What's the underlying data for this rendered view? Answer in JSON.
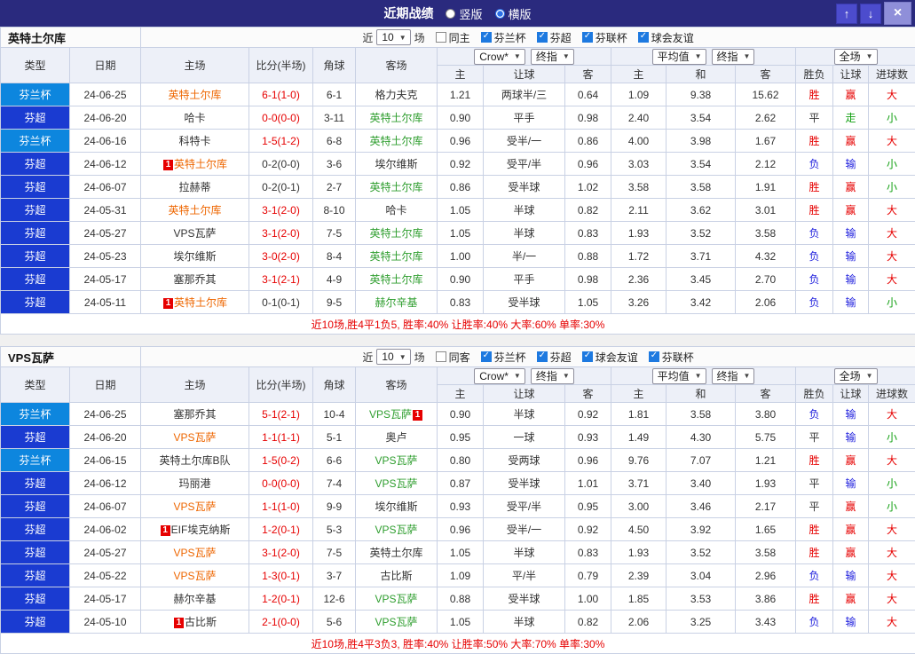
{
  "topbar": {
    "title": "近期战绩",
    "radios": [
      {
        "label": "竖版",
        "checked": false
      },
      {
        "label": "横版",
        "checked": true
      }
    ],
    "up_icon": "↑",
    "down_icon": "↓",
    "close_icon": "×"
  },
  "recent": {
    "prefix": "近",
    "suffix": "场"
  },
  "columns": [
    "类型",
    "日期",
    "主场",
    "比分(半场)",
    "角球",
    "客场",
    "主",
    "让球",
    "客",
    "主",
    "和",
    "客",
    "胜负",
    "让球",
    "进球数"
  ],
  "selects": {
    "book": "Crow*",
    "final1": "终指",
    "avg": "平均值",
    "final2": "终指",
    "scope": "全场"
  },
  "colors": {
    "topbar": "#2a2a7e",
    "cup": "#0d86de",
    "league": "#1a3bd1",
    "red": "#e60000",
    "blue": "#2020dd",
    "green": "#12a012",
    "tred": "#ee6600",
    "tgreen": "#2f9e2f"
  },
  "sections": [
    {
      "team": "英特土尔库",
      "recent_count": "10",
      "same_label": "同主",
      "filters": [
        "芬兰杯",
        "芬超",
        "芬联杯",
        "球会友谊"
      ],
      "footer": "近10场,胜4平1负5, 胜率:40% 让胜率:40% 大率:60% 单率:30%",
      "rows": [
        {
          "type": "芬兰杯",
          "tc": "cup",
          "date": "24-06-25",
          "home": "英特土尔库",
          "hc": "red",
          "hb": "",
          "score": "6-1(1-0)",
          "sc": "red",
          "corner": "6-1",
          "away": "格力夫克",
          "ac": "",
          "ab": "",
          "o": [
            "1.21",
            "两球半/三",
            "0.64"
          ],
          "m": [
            "1.09",
            "9.38",
            "15.62"
          ],
          "res": [
            [
              "胜",
              "red"
            ],
            [
              "赢",
              "red"
            ],
            [
              "大",
              "red"
            ]
          ]
        },
        {
          "type": "芬超",
          "tc": "league",
          "date": "24-06-20",
          "home": "哈卡",
          "hc": "",
          "hb": "",
          "score": "0-0(0-0)",
          "sc": "red",
          "corner": "3-11",
          "away": "英特土尔库",
          "ac": "green",
          "ab": "",
          "o": [
            "0.90",
            "平手",
            "0.98"
          ],
          "m": [
            "2.40",
            "3.54",
            "2.62"
          ],
          "res": [
            [
              "平",
              ""
            ],
            [
              "走",
              "green"
            ],
            [
              "小",
              "green"
            ]
          ]
        },
        {
          "type": "芬兰杯",
          "tc": "cup",
          "date": "24-06-16",
          "home": "科特卡",
          "hc": "",
          "hb": "",
          "score": "1-5(1-2)",
          "sc": "red",
          "corner": "6-8",
          "away": "英特土尔库",
          "ac": "green",
          "ab": "",
          "o": [
            "0.96",
            "受半/一",
            "0.86"
          ],
          "m": [
            "4.00",
            "3.98",
            "1.67"
          ],
          "res": [
            [
              "胜",
              "red"
            ],
            [
              "赢",
              "red"
            ],
            [
              "大",
              "red"
            ]
          ]
        },
        {
          "type": "芬超",
          "tc": "league",
          "date": "24-06-12",
          "home": "英特土尔库",
          "hc": "red",
          "hb": "before",
          "score": "0-2(0-0)",
          "sc": "",
          "corner": "3-6",
          "away": "埃尔维斯",
          "ac": "",
          "ab": "",
          "o": [
            "0.92",
            "受平/半",
            "0.96"
          ],
          "m": [
            "3.03",
            "3.54",
            "2.12"
          ],
          "res": [
            [
              "负",
              "blue"
            ],
            [
              "输",
              "blue"
            ],
            [
              "小",
              "green"
            ]
          ]
        },
        {
          "type": "芬超",
          "tc": "league",
          "date": "24-06-07",
          "home": "拉赫蒂",
          "hc": "",
          "hb": "",
          "score": "0-2(0-1)",
          "sc": "",
          "corner": "2-7",
          "away": "英特土尔库",
          "ac": "green",
          "ab": "",
          "o": [
            "0.86",
            "受半球",
            "1.02"
          ],
          "m": [
            "3.58",
            "3.58",
            "1.91"
          ],
          "res": [
            [
              "胜",
              "red"
            ],
            [
              "赢",
              "red"
            ],
            [
              "小",
              "green"
            ]
          ]
        },
        {
          "type": "芬超",
          "tc": "league",
          "date": "24-05-31",
          "home": "英特土尔库",
          "hc": "red",
          "hb": "",
          "score": "3-1(2-0)",
          "sc": "red",
          "corner": "8-10",
          "away": "哈卡",
          "ac": "",
          "ab": "",
          "o": [
            "1.05",
            "半球",
            "0.82"
          ],
          "m": [
            "2.11",
            "3.62",
            "3.01"
          ],
          "res": [
            [
              "胜",
              "red"
            ],
            [
              "赢",
              "red"
            ],
            [
              "大",
              "red"
            ]
          ]
        },
        {
          "type": "芬超",
          "tc": "league",
          "date": "24-05-27",
          "home": "VPS瓦萨",
          "hc": "",
          "hb": "",
          "score": "3-1(2-0)",
          "sc": "red",
          "corner": "7-5",
          "away": "英特土尔库",
          "ac": "green",
          "ab": "",
          "o": [
            "1.05",
            "半球",
            "0.83"
          ],
          "m": [
            "1.93",
            "3.52",
            "3.58"
          ],
          "res": [
            [
              "负",
              "blue"
            ],
            [
              "输",
              "blue"
            ],
            [
              "大",
              "red"
            ]
          ]
        },
        {
          "type": "芬超",
          "tc": "league",
          "date": "24-05-23",
          "home": "埃尔维斯",
          "hc": "",
          "hb": "",
          "score": "3-0(2-0)",
          "sc": "red",
          "corner": "8-4",
          "away": "英特土尔库",
          "ac": "green",
          "ab": "",
          "o": [
            "1.00",
            "半/一",
            "0.88"
          ],
          "m": [
            "1.72",
            "3.71",
            "4.32"
          ],
          "res": [
            [
              "负",
              "blue"
            ],
            [
              "输",
              "blue"
            ],
            [
              "大",
              "red"
            ]
          ]
        },
        {
          "type": "芬超",
          "tc": "league",
          "date": "24-05-17",
          "home": "塞那乔其",
          "hc": "",
          "hb": "",
          "score": "3-1(2-1)",
          "sc": "red",
          "corner": "4-9",
          "away": "英特土尔库",
          "ac": "green",
          "ab": "",
          "o": [
            "0.90",
            "平手",
            "0.98"
          ],
          "m": [
            "2.36",
            "3.45",
            "2.70"
          ],
          "res": [
            [
              "负",
              "blue"
            ],
            [
              "输",
              "blue"
            ],
            [
              "大",
              "red"
            ]
          ]
        },
        {
          "type": "芬超",
          "tc": "league",
          "date": "24-05-11",
          "home": "英特土尔库",
          "hc": "red",
          "hb": "before",
          "score": "0-1(0-1)",
          "sc": "",
          "corner": "9-5",
          "away": "赫尔辛基",
          "ac": "green",
          "ab": "",
          "o": [
            "0.83",
            "受半球",
            "1.05"
          ],
          "m": [
            "3.26",
            "3.42",
            "2.06"
          ],
          "res": [
            [
              "负",
              "blue"
            ],
            [
              "输",
              "blue"
            ],
            [
              "小",
              "green"
            ]
          ]
        }
      ]
    },
    {
      "team": "VPS瓦萨",
      "recent_count": "10",
      "same_label": "同客",
      "filters": [
        "芬兰杯",
        "芬超",
        "球会友谊",
        "芬联杯"
      ],
      "footer": "近10场,胜4平3负3, 胜率:40% 让胜率:50% 大率:70% 单率:30%",
      "rows": [
        {
          "type": "芬兰杯",
          "tc": "cup",
          "date": "24-06-25",
          "home": "塞那乔其",
          "hc": "",
          "hb": "",
          "score": "5-1(2-1)",
          "sc": "red",
          "corner": "10-4",
          "away": "VPS瓦萨",
          "ac": "green",
          "ab": "after",
          "o": [
            "0.90",
            "半球",
            "0.92"
          ],
          "m": [
            "1.81",
            "3.58",
            "3.80"
          ],
          "res": [
            [
              "负",
              "blue"
            ],
            [
              "输",
              "blue"
            ],
            [
              "大",
              "red"
            ]
          ]
        },
        {
          "type": "芬超",
          "tc": "league",
          "date": "24-06-20",
          "home": "VPS瓦萨",
          "hc": "red",
          "hb": "",
          "score": "1-1(1-1)",
          "sc": "red",
          "corner": "5-1",
          "away": "奥卢",
          "ac": "",
          "ab": "",
          "o": [
            "0.95",
            "一球",
            "0.93"
          ],
          "m": [
            "1.49",
            "4.30",
            "5.75"
          ],
          "res": [
            [
              "平",
              ""
            ],
            [
              "输",
              "blue"
            ],
            [
              "小",
              "green"
            ]
          ]
        },
        {
          "type": "芬兰杯",
          "tc": "cup",
          "date": "24-06-15",
          "home": "英特土尔库B队",
          "hc": "",
          "hb": "",
          "score": "1-5(0-2)",
          "sc": "red",
          "corner": "6-6",
          "away": "VPS瓦萨",
          "ac": "green",
          "ab": "",
          "o": [
            "0.80",
            "受两球",
            "0.96"
          ],
          "m": [
            "9.76",
            "7.07",
            "1.21"
          ],
          "res": [
            [
              "胜",
              "red"
            ],
            [
              "赢",
              "red"
            ],
            [
              "大",
              "red"
            ]
          ]
        },
        {
          "type": "芬超",
          "tc": "league",
          "date": "24-06-12",
          "home": "玛丽港",
          "hc": "",
          "hb": "",
          "score": "0-0(0-0)",
          "sc": "red",
          "corner": "7-4",
          "away": "VPS瓦萨",
          "ac": "green",
          "ab": "",
          "o": [
            "0.87",
            "受半球",
            "1.01"
          ],
          "m": [
            "3.71",
            "3.40",
            "1.93"
          ],
          "res": [
            [
              "平",
              ""
            ],
            [
              "输",
              "blue"
            ],
            [
              "小",
              "green"
            ]
          ]
        },
        {
          "type": "芬超",
          "tc": "league",
          "date": "24-06-07",
          "home": "VPS瓦萨",
          "hc": "red",
          "hb": "",
          "score": "1-1(1-0)",
          "sc": "red",
          "corner": "9-9",
          "away": "埃尔维斯",
          "ac": "",
          "ab": "",
          "o": [
            "0.93",
            "受平/半",
            "0.95"
          ],
          "m": [
            "3.00",
            "3.46",
            "2.17"
          ],
          "res": [
            [
              "平",
              ""
            ],
            [
              "赢",
              "red"
            ],
            [
              "小",
              "green"
            ]
          ]
        },
        {
          "type": "芬超",
          "tc": "league",
          "date": "24-06-02",
          "home": "EIF埃克纳斯",
          "hc": "",
          "hb": "before",
          "score": "1-2(0-1)",
          "sc": "red",
          "corner": "5-3",
          "away": "VPS瓦萨",
          "ac": "green",
          "ab": "",
          "o": [
            "0.96",
            "受半/一",
            "0.92"
          ],
          "m": [
            "4.50",
            "3.92",
            "1.65"
          ],
          "res": [
            [
              "胜",
              "red"
            ],
            [
              "赢",
              "red"
            ],
            [
              "大",
              "red"
            ]
          ]
        },
        {
          "type": "芬超",
          "tc": "league",
          "date": "24-05-27",
          "home": "VPS瓦萨",
          "hc": "red",
          "hb": "",
          "score": "3-1(2-0)",
          "sc": "red",
          "corner": "7-5",
          "away": "英特土尔库",
          "ac": "",
          "ab": "",
          "o": [
            "1.05",
            "半球",
            "0.83"
          ],
          "m": [
            "1.93",
            "3.52",
            "3.58"
          ],
          "res": [
            [
              "胜",
              "red"
            ],
            [
              "赢",
              "red"
            ],
            [
              "大",
              "red"
            ]
          ]
        },
        {
          "type": "芬超",
          "tc": "league",
          "date": "24-05-22",
          "home": "VPS瓦萨",
          "hc": "red",
          "hb": "",
          "score": "1-3(0-1)",
          "sc": "red",
          "corner": "3-7",
          "away": "古比斯",
          "ac": "",
          "ab": "",
          "o": [
            "1.09",
            "平/半",
            "0.79"
          ],
          "m": [
            "2.39",
            "3.04",
            "2.96"
          ],
          "res": [
            [
              "负",
              "blue"
            ],
            [
              "输",
              "blue"
            ],
            [
              "大",
              "red"
            ]
          ]
        },
        {
          "type": "芬超",
          "tc": "league",
          "date": "24-05-17",
          "home": "赫尔辛基",
          "hc": "",
          "hb": "",
          "score": "1-2(0-1)",
          "sc": "red",
          "corner": "12-6",
          "away": "VPS瓦萨",
          "ac": "green",
          "ab": "",
          "o": [
            "0.88",
            "受半球",
            "1.00"
          ],
          "m": [
            "1.85",
            "3.53",
            "3.86"
          ],
          "res": [
            [
              "胜",
              "red"
            ],
            [
              "赢",
              "red"
            ],
            [
              "大",
              "red"
            ]
          ]
        },
        {
          "type": "芬超",
          "tc": "league",
          "date": "24-05-10",
          "home": "古比斯",
          "hc": "",
          "hb": "before",
          "score": "2-1(0-0)",
          "sc": "red",
          "corner": "5-6",
          "away": "VPS瓦萨",
          "ac": "green",
          "ab": "",
          "o": [
            "1.05",
            "半球",
            "0.82"
          ],
          "m": [
            "2.06",
            "3.25",
            "3.43"
          ],
          "res": [
            [
              "负",
              "blue"
            ],
            [
              "输",
              "blue"
            ],
            [
              "大",
              "red"
            ]
          ]
        }
      ]
    }
  ]
}
